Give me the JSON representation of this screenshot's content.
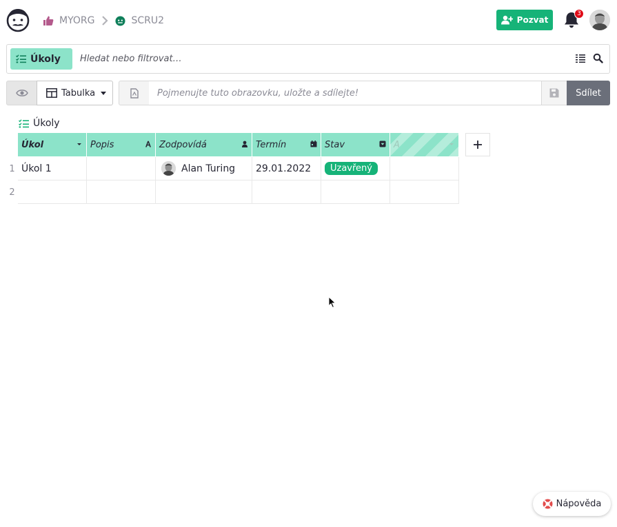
{
  "header": {
    "org_name": "MYORG",
    "workspace_name": "SCRU2",
    "invite_label": "Pozvat",
    "notifications_count": "3"
  },
  "search": {
    "page_name": "Úkoly",
    "placeholder": "Hledat nebo filtrovat…"
  },
  "toolbar": {
    "view_type": "Tabulka",
    "name_placeholder": "Pojmenujte tuto obrazovku, uložte a sdílejte!",
    "share_label": "Sdílet"
  },
  "section": {
    "title": "Úkoly"
  },
  "table": {
    "columns": [
      {
        "label": "Úkol",
        "type_icon": "dropdown-caret-icon"
      },
      {
        "label": "Popis",
        "type_icon": "text-type-icon"
      },
      {
        "label": "Zodpovídá",
        "type_icon": "person-icon"
      },
      {
        "label": "Termín",
        "type_icon": "calendar-icon"
      },
      {
        "label": "Stav",
        "type_icon": "choice-icon"
      },
      {
        "label": "A",
        "type_icon": "dropdown-caret-icon"
      }
    ],
    "rows": [
      {
        "num": "1",
        "ukol": "Úkol 1",
        "popis": "",
        "zodpovida": "Alan Turing",
        "termin": "29.01.2022",
        "stav": "Uzavřený",
        "a": ""
      },
      {
        "num": "2",
        "ukol": "",
        "popis": "",
        "zodpovida": "",
        "termin": "",
        "stav": "",
        "a": ""
      }
    ]
  },
  "help": {
    "label": "Nápověda"
  },
  "colors": {
    "accent": "#16b378",
    "header_cell": "#8ce3c9",
    "badge": "#e00a17"
  }
}
